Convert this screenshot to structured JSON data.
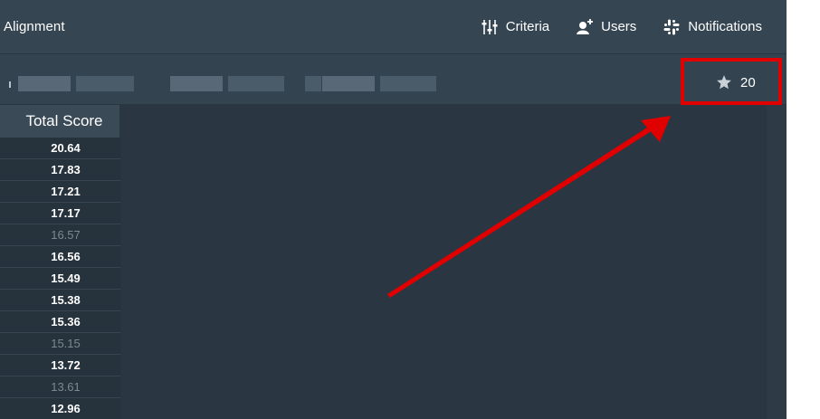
{
  "header": {
    "title": "Alignment",
    "nav": [
      {
        "label": "Criteria",
        "icon": "sliders-icon"
      },
      {
        "label": "Users",
        "icon": "add-user-icon"
      },
      {
        "label": "Notifications",
        "icon": "slack-icon"
      }
    ]
  },
  "subbar": {
    "star_count": "20"
  },
  "table": {
    "column_header": "Total Score",
    "rows": [
      {
        "value": "20.64",
        "dim": false
      },
      {
        "value": "17.83",
        "dim": false
      },
      {
        "value": "17.21",
        "dim": false
      },
      {
        "value": "17.17",
        "dim": false
      },
      {
        "value": "16.57",
        "dim": true
      },
      {
        "value": "16.56",
        "dim": false
      },
      {
        "value": "15.49",
        "dim": false
      },
      {
        "value": "15.38",
        "dim": false
      },
      {
        "value": "15.36",
        "dim": false
      },
      {
        "value": "15.15",
        "dim": true
      },
      {
        "value": "13.72",
        "dim": false
      },
      {
        "value": "13.61",
        "dim": true
      },
      {
        "value": "12.96",
        "dim": false
      }
    ]
  },
  "colors": {
    "annotation": "#e00000",
    "background": "#2a3742",
    "header": "#354552"
  }
}
